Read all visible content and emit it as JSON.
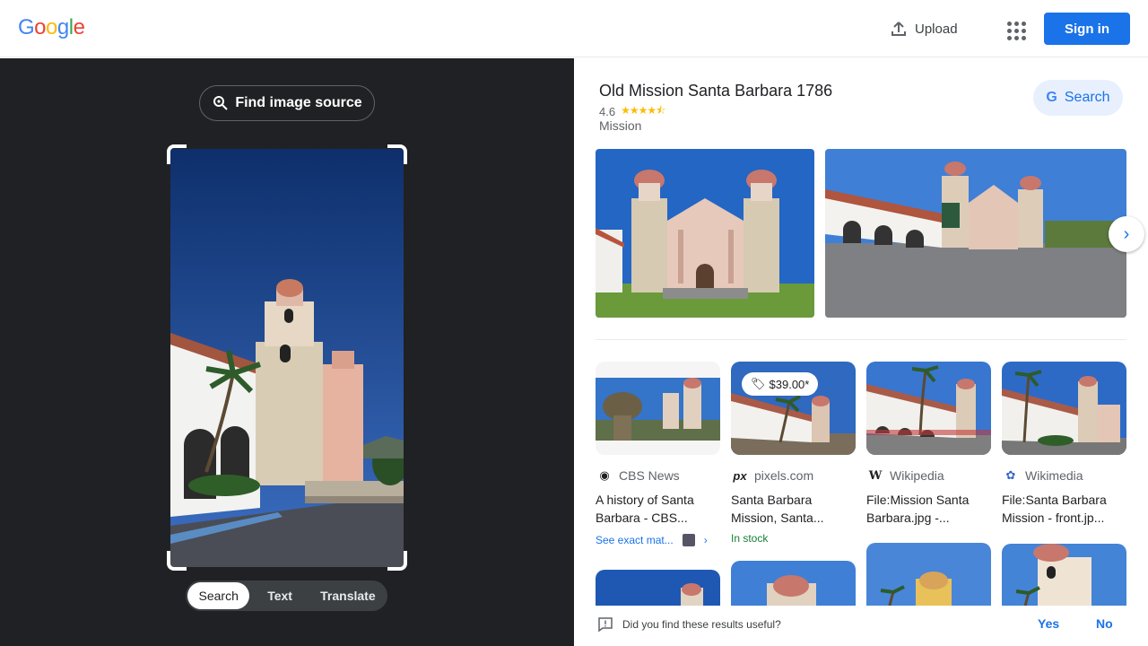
{
  "header": {
    "logo_letters": [
      {
        "ch": "G",
        "color": "#4285f4"
      },
      {
        "ch": "o",
        "color": "#ea4335"
      },
      {
        "ch": "o",
        "color": "#fbbc05"
      },
      {
        "ch": "g",
        "color": "#4285f4"
      },
      {
        "ch": "l",
        "color": "#34a853"
      },
      {
        "ch": "e",
        "color": "#ea4335"
      }
    ],
    "upload_label": "Upload",
    "apps_icon": "apps-grid-icon",
    "signin_label": "Sign in"
  },
  "left": {
    "find_source_label": "Find image source",
    "modes": [
      {
        "label": "Search",
        "active": true
      },
      {
        "label": "Text",
        "active": false
      },
      {
        "label": "Translate",
        "active": false
      }
    ]
  },
  "knowledge_panel": {
    "title": "Old Mission Santa Barbara 1786",
    "rating": "4.6",
    "stars": "★★★★⯪",
    "type": "Mission",
    "search_label": "Search"
  },
  "results": [
    {
      "source": "CBS News",
      "title": "A history of Santa Barbara - CBS...",
      "exact": "See exact mat..."
    },
    {
      "source": "pixels.com",
      "title": "Santa Barbara Mission, Santa...",
      "price": "$39.00*",
      "extra": "In stock"
    },
    {
      "source": "Wikipedia",
      "title": "File:Mission Santa Barbara.jpg -..."
    },
    {
      "source": "Wikimedia",
      "title": "File:Santa Barbara Mission - front.jp..."
    }
  ],
  "feedback": {
    "question": "Did you find these results useful?",
    "yes": "Yes",
    "no": "No"
  },
  "colors": {
    "accent": "#1a73e8",
    "left_bg": "#202124"
  }
}
